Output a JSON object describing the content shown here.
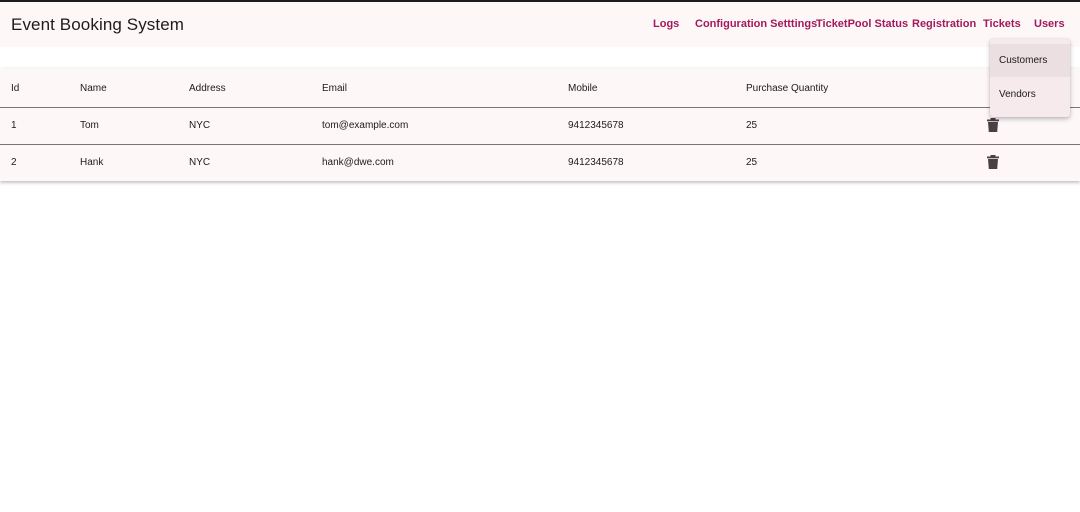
{
  "app": {
    "title": "Event Booking System"
  },
  "nav": {
    "logs": "Logs",
    "config": "Configuration Setttings",
    "ticketpool": "TicketPool Status",
    "registration": "Registration",
    "tickets": "Tickets",
    "users": "Users"
  },
  "users_menu": {
    "items": [
      {
        "label": "Customers"
      },
      {
        "label": "Vendors"
      }
    ]
  },
  "table": {
    "headers": {
      "id": "Id",
      "name": "Name",
      "address": "Address",
      "email": "Email",
      "mobile": "Mobile",
      "purchase_quantity": "Purchase Quantity"
    },
    "rows": [
      {
        "id": "1",
        "name": "Tom",
        "address": "NYC",
        "email": "tom@example.com",
        "mobile": "9412345678",
        "purchase_quantity": "25"
      },
      {
        "id": "2",
        "name": "Hank",
        "address": "NYC",
        "email": "hank@dwe.com",
        "mobile": "9412345678",
        "purchase_quantity": "25"
      }
    ]
  },
  "colors": {
    "accent": "#a3195b",
    "surface": "#fdf7f8",
    "menu_bg": "#f6eaec",
    "icon": "#4a3f44"
  },
  "icons": {
    "row_action": "delete-icon"
  }
}
